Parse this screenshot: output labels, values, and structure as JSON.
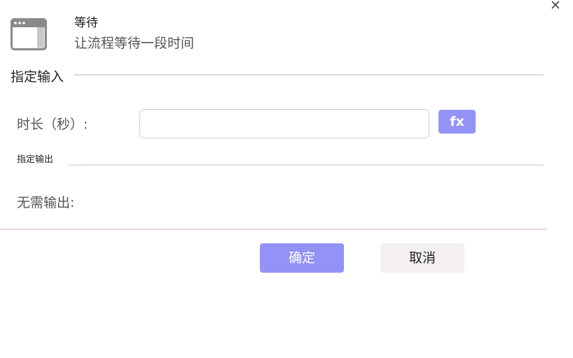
{
  "header": {
    "icon": "window-icon",
    "title": "等待",
    "subtitle": "让流程等待一段时间"
  },
  "close": {
    "icon": "close-icon"
  },
  "input_section": {
    "title": "指定输入",
    "duration_label": "时长（秒）:",
    "duration_value": "",
    "fx_label": "fx"
  },
  "output_section": {
    "title": "指定输出",
    "no_output_label": "无需输出:"
  },
  "footer": {
    "confirm_label": "确定",
    "cancel_label": "取消"
  },
  "colors": {
    "accent": "#9393f7",
    "cancel_bg": "#f4f0f0",
    "divider": "#ead3ea"
  }
}
